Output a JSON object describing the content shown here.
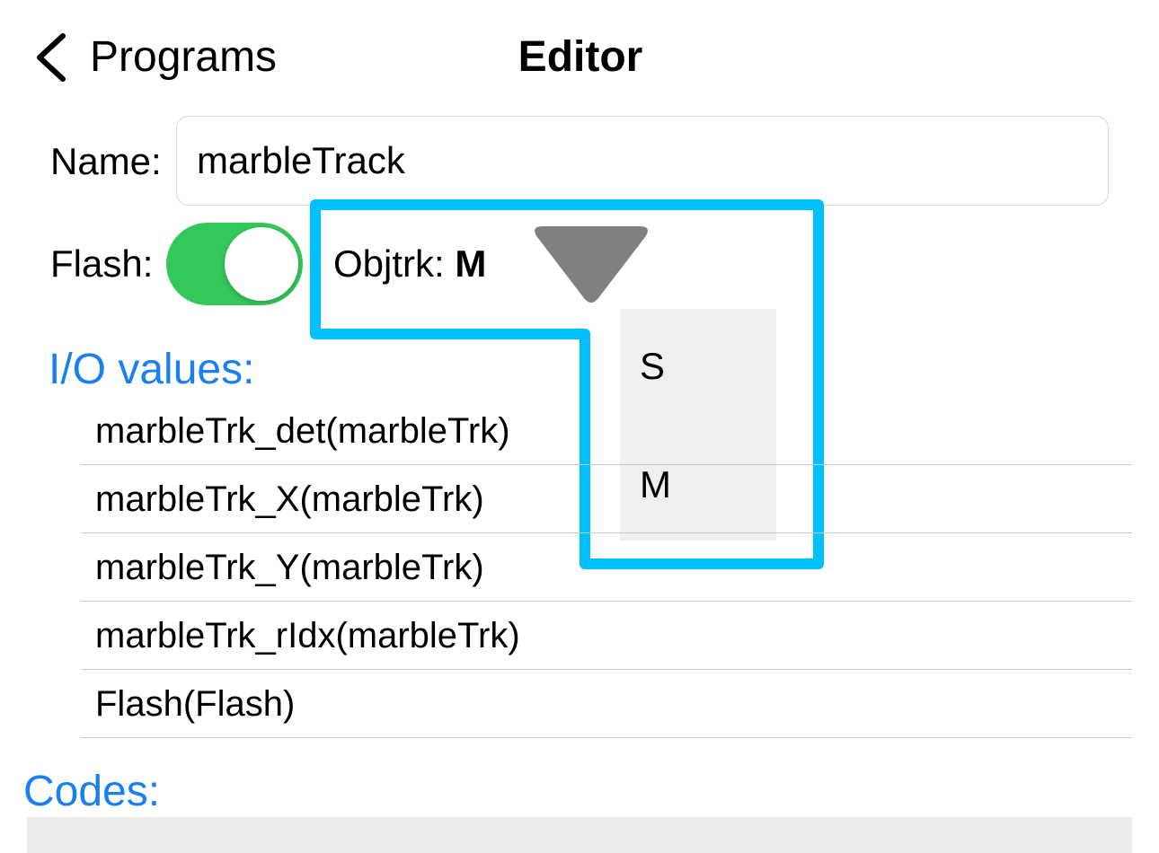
{
  "nav": {
    "back_label": "Programs",
    "title": "Editor",
    "back_icon": "chevron-left-icon"
  },
  "name_field": {
    "label": "Name:",
    "value": "marbleTrack"
  },
  "flash": {
    "label": "Flash:",
    "on": true,
    "color": "#34c759"
  },
  "objtrk": {
    "label": "Objtrk:",
    "value": "M",
    "options": [
      "S",
      "M"
    ],
    "arrow_icon": "triangle-down-icon",
    "highlight_color": "#00bfff"
  },
  "io": {
    "header": "I/O values:",
    "items": [
      "marbleTrk_det(marbleTrk)",
      "marbleTrk_X(marbleTrk)",
      "marbleTrk_Y(marbleTrk)",
      "marbleTrk_rIdx(marbleTrk)",
      "Flash(Flash)"
    ]
  },
  "codes": {
    "header": "Codes:"
  },
  "colors": {
    "accent": "#1a7ff0"
  }
}
